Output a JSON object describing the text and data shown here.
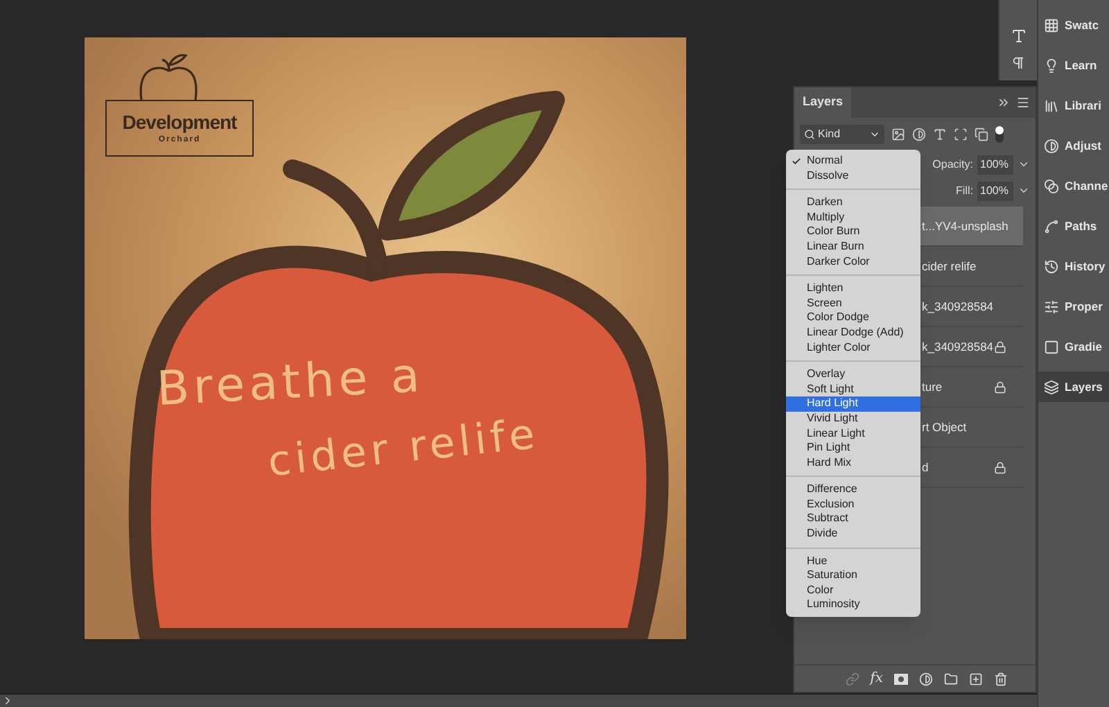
{
  "canvas": {
    "logo_title": "Development",
    "logo_subtitle": "Orchard",
    "headline": [
      "Breathe a",
      "cider relife"
    ]
  },
  "layers_panel": {
    "title": "Layers",
    "filter": "Kind",
    "opacity_label": "Opacity:",
    "opacity": "100%",
    "fill_label": "Fill:",
    "fill": "100%",
    "effects_label": "fx",
    "layers": [
      {
        "name": "t...YV4-unsplash",
        "locked": false,
        "selected": true
      },
      {
        "name": "cider relife",
        "locked": false,
        "selected": false
      },
      {
        "name": "k_340928584",
        "locked": false,
        "selected": false
      },
      {
        "name": "k_340928584",
        "locked": true,
        "selected": false
      },
      {
        "name": "ture",
        "locked": true,
        "selected": false
      },
      {
        "name": "rt Object",
        "locked": false,
        "selected": false
      },
      {
        "name": "d",
        "locked": true,
        "selected": false
      }
    ]
  },
  "blend_menu": {
    "groups": [
      {
        "items": [
          {
            "label": "Normal",
            "checked": true,
            "selected": false
          },
          {
            "label": "Dissolve",
            "checked": false,
            "selected": false
          }
        ]
      },
      {
        "items": [
          {
            "label": "Darken",
            "checked": false,
            "selected": false
          },
          {
            "label": "Multiply",
            "checked": false,
            "selected": false
          },
          {
            "label": "Color Burn",
            "checked": false,
            "selected": false
          },
          {
            "label": "Linear Burn",
            "checked": false,
            "selected": false
          },
          {
            "label": "Darker Color",
            "checked": false,
            "selected": false
          }
        ]
      },
      {
        "items": [
          {
            "label": "Lighten",
            "checked": false,
            "selected": false
          },
          {
            "label": "Screen",
            "checked": false,
            "selected": false
          },
          {
            "label": "Color Dodge",
            "checked": false,
            "selected": false
          },
          {
            "label": "Linear Dodge (Add)",
            "checked": false,
            "selected": false
          },
          {
            "label": "Lighter Color",
            "checked": false,
            "selected": false
          }
        ]
      },
      {
        "items": [
          {
            "label": "Overlay",
            "checked": false,
            "selected": false
          },
          {
            "label": "Soft Light",
            "checked": false,
            "selected": false
          },
          {
            "label": "Hard Light",
            "checked": false,
            "selected": true
          },
          {
            "label": "Vivid Light",
            "checked": false,
            "selected": false
          },
          {
            "label": "Linear Light",
            "checked": false,
            "selected": false
          },
          {
            "label": "Pin Light",
            "checked": false,
            "selected": false
          },
          {
            "label": "Hard Mix",
            "checked": false,
            "selected": false
          }
        ]
      },
      {
        "items": [
          {
            "label": "Difference",
            "checked": false,
            "selected": false
          },
          {
            "label": "Exclusion",
            "checked": false,
            "selected": false
          },
          {
            "label": "Subtract",
            "checked": false,
            "selected": false
          },
          {
            "label": "Divide",
            "checked": false,
            "selected": false
          }
        ]
      },
      {
        "items": [
          {
            "label": "Hue",
            "checked": false,
            "selected": false
          },
          {
            "label": "Saturation",
            "checked": false,
            "selected": false
          },
          {
            "label": "Color",
            "checked": false,
            "selected": false
          },
          {
            "label": "Luminosity",
            "checked": false,
            "selected": false
          }
        ]
      }
    ]
  },
  "dock": [
    {
      "label": "Swatc",
      "selected": false
    },
    {
      "label": "Learn",
      "selected": false
    },
    {
      "label": "Librari",
      "selected": false
    },
    {
      "label": "Adjust",
      "selected": false
    },
    {
      "label": "Channe",
      "selected": false
    },
    {
      "label": "Paths",
      "selected": false
    },
    {
      "label": "History",
      "selected": false
    },
    {
      "label": "Proper",
      "selected": false
    },
    {
      "label": "Gradie",
      "selected": false
    },
    {
      "label": "Layers",
      "selected": true
    }
  ]
}
